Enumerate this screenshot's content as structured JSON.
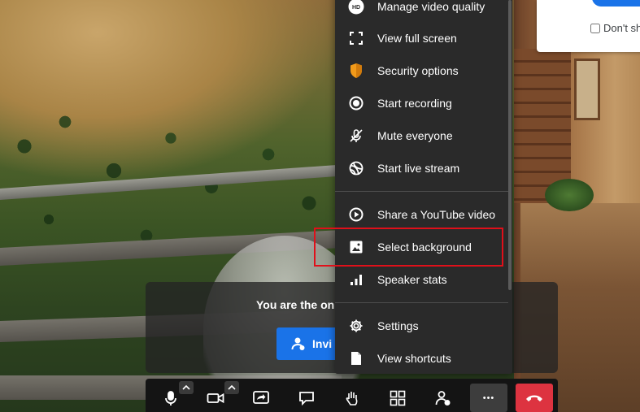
{
  "card": {
    "checkbox_label": "Don't sh"
  },
  "banner": {
    "message": "You are the on",
    "invite_label": "Invi"
  },
  "menu": {
    "items": [
      {
        "label": "Manage video quality",
        "icon": "hd-icon"
      },
      {
        "label": "View full screen",
        "icon": "fullscreen-icon"
      },
      {
        "label": "Security options",
        "icon": "shield-icon"
      },
      {
        "label": "Start recording",
        "icon": "record-icon"
      },
      {
        "label": "Mute everyone",
        "icon": "mic-off-icon"
      },
      {
        "label": "Start live stream",
        "icon": "live-stream-icon"
      },
      {
        "label": "Share a YouTube video",
        "icon": "play-icon"
      },
      {
        "label": "Select background",
        "icon": "image-icon"
      },
      {
        "label": "Speaker stats",
        "icon": "bar-chart-icon"
      },
      {
        "label": "Settings",
        "icon": "gear-icon"
      },
      {
        "label": "View shortcuts",
        "icon": "document-icon"
      }
    ],
    "hd_badge": "HD",
    "highlighted_item": "Select background"
  },
  "toolbar": {
    "buttons": [
      {
        "name": "microphone-button",
        "icon": "microphone-icon"
      },
      {
        "name": "camera-button",
        "icon": "camera-icon"
      },
      {
        "name": "screen-share-button",
        "icon": "screen-share-icon"
      },
      {
        "name": "chat-button",
        "icon": "chat-icon"
      },
      {
        "name": "raise-hand-button",
        "icon": "hand-icon"
      },
      {
        "name": "tile-view-button",
        "icon": "grid-icon"
      },
      {
        "name": "participants-button",
        "icon": "add-user-icon"
      },
      {
        "name": "more-actions-button",
        "icon": "more-icon"
      },
      {
        "name": "hangup-button",
        "icon": "phone-hangup-icon"
      }
    ],
    "more_glyph": "•••"
  },
  "colors": {
    "menu_bg": "#2a2a2a",
    "primary_blue": "#1a73e8",
    "hangup_red": "#dd3340",
    "highlight_red": "#e0101a",
    "security_orange": "#f19a1a"
  }
}
